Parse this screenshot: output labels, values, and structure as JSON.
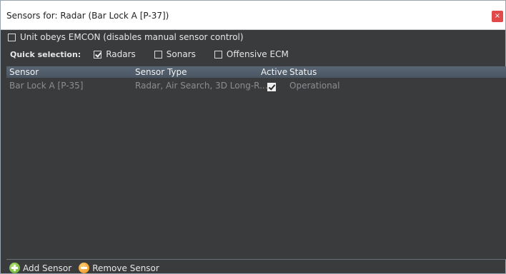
{
  "window": {
    "title": "Sensors for: Radar (Bar Lock A [P-37])",
    "close_glyph": "×"
  },
  "emcon": {
    "label": "Unit obeys EMCON (disables manual sensor control)",
    "checked": false
  },
  "quick_selection": {
    "label": "Quick selection:",
    "options": [
      {
        "label": "Radars",
        "checked": true
      },
      {
        "label": "Sonars",
        "checked": false
      },
      {
        "label": "Offensive ECM",
        "checked": false
      }
    ]
  },
  "grid": {
    "columns": [
      "Sensor",
      "Sensor Type",
      "Active",
      "Status"
    ],
    "rows": [
      {
        "sensor": "Bar Lock A [P-35]",
        "type": "Radar, Air Search, 3D Long-R...",
        "active": true,
        "status": "Operational"
      }
    ]
  },
  "footer": {
    "add_label": "Add Sensor",
    "remove_label": "Remove Sensor"
  },
  "icons": {
    "add": "plus-circle-icon",
    "remove": "minus-circle-icon",
    "close": "close-icon"
  },
  "colors": {
    "background": "#3a3b3d",
    "header": "#52606c",
    "close": "#e24a4a",
    "add_icon": "#6cb52e",
    "remove_icon": "#f09a18"
  }
}
